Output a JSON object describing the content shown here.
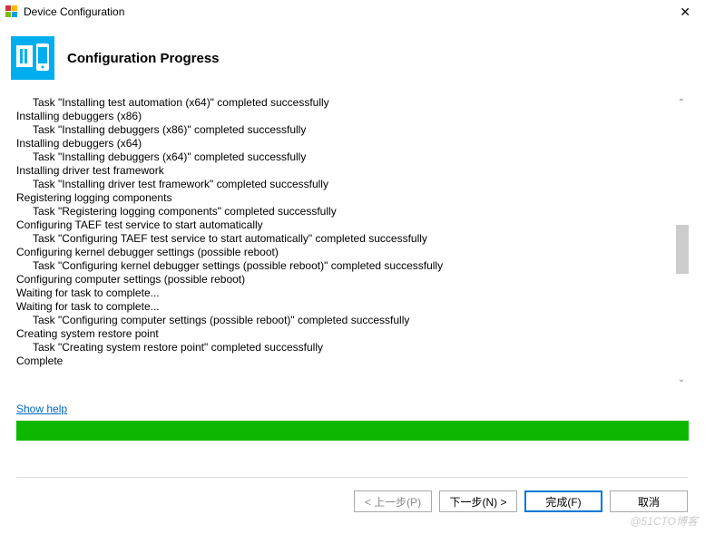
{
  "window": {
    "title": "Device Configuration"
  },
  "header": {
    "title": "Configuration Progress"
  },
  "log": {
    "lines": [
      {
        "text": "Task \"Installing test automation (x64)\" completed successfully",
        "indent": 1
      },
      {
        "text": "Installing debuggers (x86)",
        "indent": 0
      },
      {
        "text": "Task \"Installing debuggers (x86)\" completed successfully",
        "indent": 1
      },
      {
        "text": "Installing debuggers (x64)",
        "indent": 0
      },
      {
        "text": "Task \"Installing debuggers (x64)\" completed successfully",
        "indent": 1
      },
      {
        "text": "Installing driver test framework",
        "indent": 0
      },
      {
        "text": "Task \"Installing driver test framework\" completed successfully",
        "indent": 1
      },
      {
        "text": "Registering logging components",
        "indent": 0
      },
      {
        "text": "Task \"Registering logging components\" completed successfully",
        "indent": 1
      },
      {
        "text": "Configuring TAEF test service to start automatically",
        "indent": 0
      },
      {
        "text": "Task \"Configuring TAEF test service to start automatically\" completed successfully",
        "indent": 1
      },
      {
        "text": "Configuring kernel debugger settings (possible reboot)",
        "indent": 0
      },
      {
        "text": "Task \"Configuring kernel debugger settings (possible reboot)\" completed successfully",
        "indent": 1
      },
      {
        "text": "Configuring computer settings (possible reboot)",
        "indent": 0
      },
      {
        "text": "Waiting for task to complete...",
        "indent": 0
      },
      {
        "text": "Waiting for task to complete...",
        "indent": 0
      },
      {
        "text": "Task \"Configuring computer settings (possible reboot)\" completed successfully",
        "indent": 1
      },
      {
        "text": "Creating system restore point",
        "indent": 0
      },
      {
        "text": "Task \"Creating system restore point\" completed successfully",
        "indent": 1
      },
      {
        "text": "Complete",
        "indent": 0
      }
    ]
  },
  "link": {
    "show_help": "Show help"
  },
  "progress": {
    "percent": 100
  },
  "buttons": {
    "back": "< 上一步(P)",
    "next": "下一步(N) >",
    "finish": "完成(F)",
    "cancel": "取消"
  },
  "watermark": "@51CTO博客"
}
